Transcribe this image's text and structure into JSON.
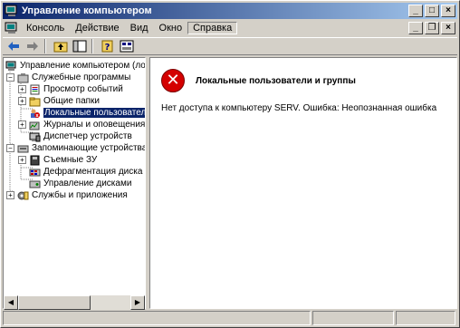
{
  "window": {
    "title": "Управление компьютером",
    "controls": {
      "minimize": "_",
      "maximize": "□",
      "close": "×"
    }
  },
  "menubar": {
    "items": [
      "Консоль",
      "Действие",
      "Вид",
      "Окно",
      "Справка"
    ],
    "active_item": "Справка",
    "child_controls": {
      "minimize": "_",
      "restore": "❐",
      "close": "×"
    }
  },
  "toolbar": {
    "buttons": [
      "back-icon",
      "forward-icon",
      "up-folder-icon",
      "show-hide-tree-icon",
      "help-icon",
      "properties-icon"
    ]
  },
  "tree": {
    "items": [
      {
        "label": "Управление компьютером (локаль",
        "icon": "computer-icon",
        "expander": "",
        "level": 0
      },
      {
        "label": "Служебные программы",
        "icon": "tools-icon",
        "expander": "−",
        "level": 1
      },
      {
        "label": "Просмотр событий",
        "icon": "event-viewer-icon",
        "expander": "+",
        "level": 2
      },
      {
        "label": "Общие папки",
        "icon": "shared-folders-icon",
        "expander": "+",
        "level": 2
      },
      {
        "label": "Локальные пользователи",
        "icon": "local-users-error-icon",
        "expander": "",
        "level": 2,
        "selected": true
      },
      {
        "label": "Журналы и оповещения пр",
        "icon": "logs-alerts-icon",
        "expander": "+",
        "level": 2
      },
      {
        "label": "Диспетчер устройств",
        "icon": "device-manager-icon",
        "expander": "",
        "level": 2
      },
      {
        "label": "Запоминающие устройства",
        "icon": "storage-icon",
        "expander": "−",
        "level": 1
      },
      {
        "label": "Съемные ЗУ",
        "icon": "removable-storage-icon",
        "expander": "+",
        "level": 2
      },
      {
        "label": "Дефрагментация диска",
        "icon": "defrag-icon",
        "expander": "",
        "level": 2
      },
      {
        "label": "Управление дисками",
        "icon": "disk-management-icon",
        "expander": "",
        "level": 2
      },
      {
        "label": "Службы и приложения",
        "icon": "services-apps-icon",
        "expander": "+",
        "level": 1
      }
    ]
  },
  "content": {
    "error_title": "Локальные пользователи и группы",
    "error_message": "Нет доступа к компьютеру SERV. Ошибка: Неопознанная ошибка",
    "error_icon": "error-x-icon",
    "error_symbol": "✕"
  },
  "colors": {
    "title_gradient_start": "#0a246a",
    "title_gradient_end": "#a6caf0",
    "face": "#d4d0c8",
    "selection": "#0a246a",
    "error_red": "#d40000"
  }
}
